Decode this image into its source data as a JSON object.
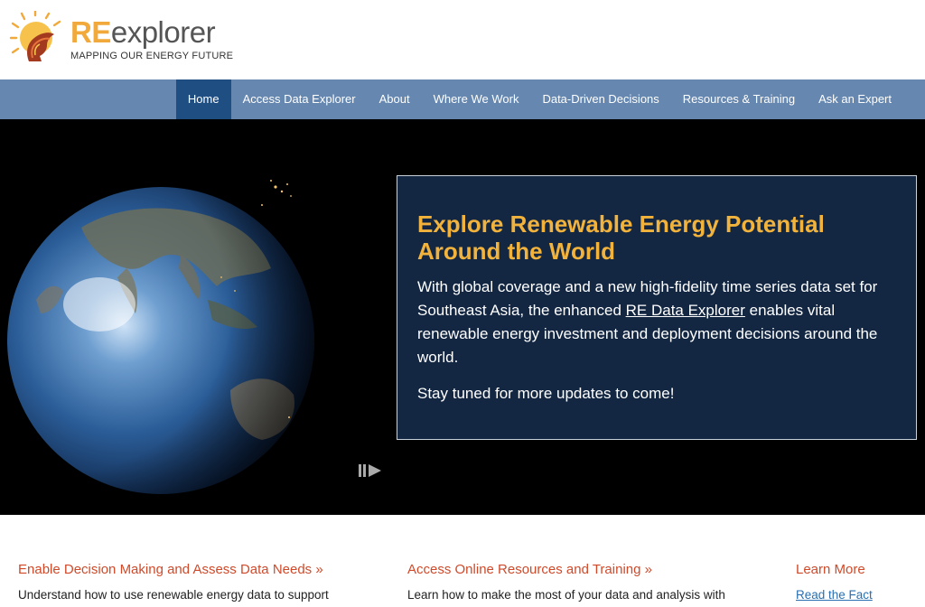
{
  "brand": {
    "name_re": "RE",
    "name_rest": "explorer",
    "tagline": "MAPPING OUR ENERGY FUTURE",
    "accent": "#f2a93b"
  },
  "nav": {
    "items": [
      {
        "label": "Home",
        "active": true
      },
      {
        "label": "Access Data Explorer"
      },
      {
        "label": "About"
      },
      {
        "label": "Where We Work"
      },
      {
        "label": "Data-Driven Decisions"
      },
      {
        "label": "Resources & Training"
      },
      {
        "label": "Ask an Expert"
      }
    ],
    "bar_color": "#6587b0",
    "active_color": "#1f4e83"
  },
  "hero": {
    "title": "Explore Renewable Energy Potential Around the World",
    "text_before_link": "With global coverage and a new high-fidelity time series data set for Southeast Asia, the enhanced ",
    "link_text": "RE Data Explorer",
    "text_after_link": " enables vital renewable energy investment and deployment decisions around the world.",
    "text2": "Stay tuned for more updates to come!",
    "play_icon": "play-pause-icon"
  },
  "cards": [
    {
      "title": "Enable Decision Making and Assess Data Needs »",
      "text": "Understand how to use renewable energy data to support"
    },
    {
      "title": "Access Online Resources and Training »",
      "text": "Learn how to make the most of your data and analysis with"
    },
    {
      "title": "Learn More",
      "link": "Read the Fact"
    }
  ]
}
